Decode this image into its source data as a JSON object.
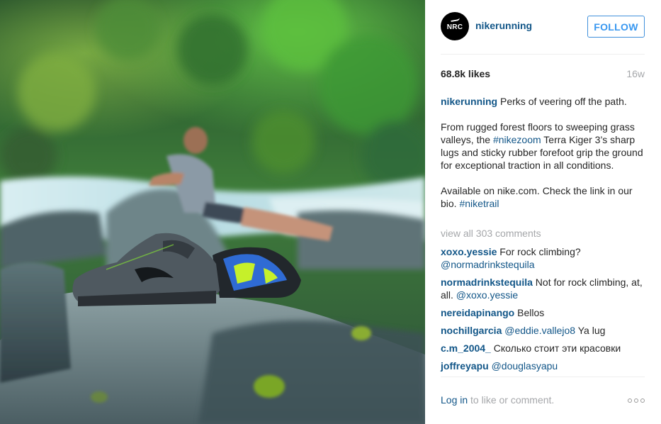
{
  "post": {
    "photo_label": "photo"
  },
  "header": {
    "avatar_text": "NRC",
    "username": "nikerunning",
    "follow_label": "FOLLOW"
  },
  "stats": {
    "likes": "68.8k likes",
    "time": "16w"
  },
  "caption": {
    "username": "nikerunning",
    "line1": "Perks of veering off the path.",
    "p2_before": "From rugged forest floors to sweeping grass valleys, the ",
    "p2_tag": "#nikezoom",
    "p2_after": " Terra Kiger 3’s sharp lugs and sticky rubber forefoot grip the ground for exceptional traction in all conditions.",
    "p3_before": "Available on nike.com. Check the link in our bio. ",
    "p3_tag": "#niketrail"
  },
  "view_all_comments": "view all 303 comments",
  "comments": [
    {
      "user": "xoxo.yessie",
      "text_before": " For rock climbing? ",
      "mention": "@normadrinkstequila",
      "text_after": ""
    },
    {
      "user": "normadrinkstequila",
      "text_before": " Not for rock climbing, at, all. ",
      "mention": "@xoxo.yessie",
      "text_after": ""
    },
    {
      "user": "nereidapinango",
      "text_before": " Bellos",
      "mention": "",
      "text_after": ""
    },
    {
      "user": "nochillgarcia",
      "text_before": " ",
      "mention": "@eddie.vallejo8",
      "text_after": " Ya lug"
    },
    {
      "user": "c.m_2004_",
      "text_before": " Сколько стоит эти красовки",
      "mention": "",
      "text_after": ""
    },
    {
      "user": "joffreyapu",
      "text_before": " ",
      "mention": "@douglasyapu",
      "text_after": ""
    }
  ],
  "footer": {
    "login_link": "Log in",
    "login_rest": " to like or comment.",
    "more_icon": "more-options-icon"
  },
  "colors": {
    "link": "#125688",
    "follow_blue": "#3897f0",
    "muted": "#a5a7aa",
    "text": "#262626"
  }
}
